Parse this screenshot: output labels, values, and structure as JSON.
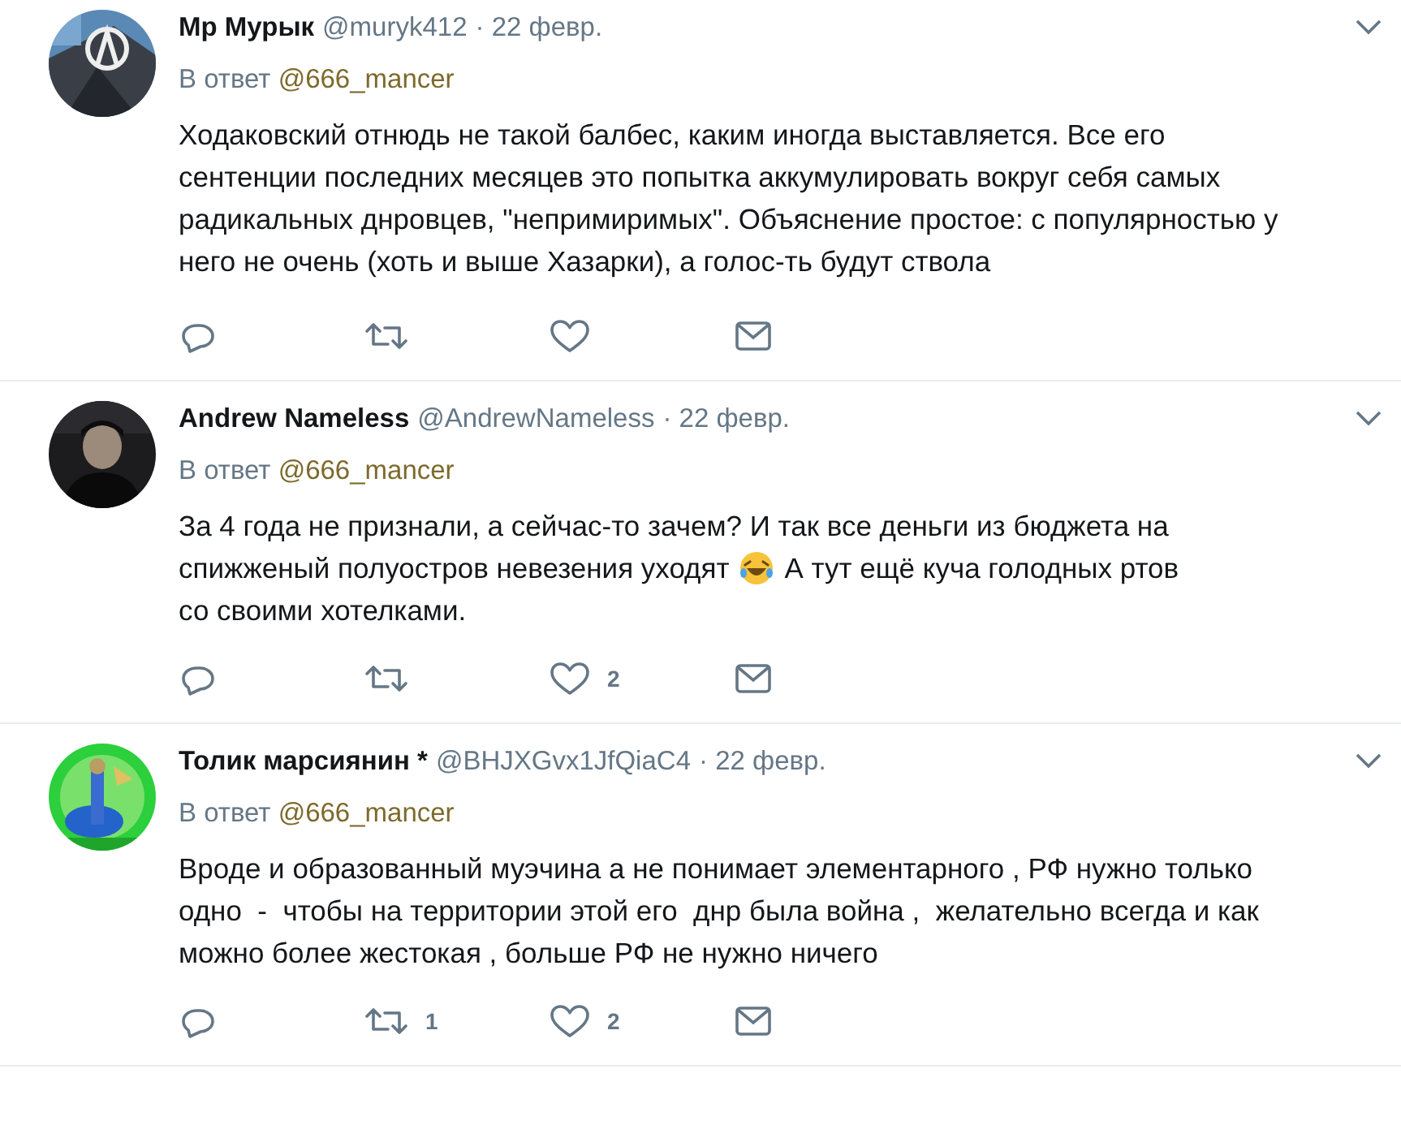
{
  "tweets": [
    {
      "name": "Мр Мурык",
      "handle": "@muryk412",
      "date": "· 22 февр.",
      "reply_prefix": "В ответ",
      "reply_to": "@666_mancer",
      "body": [
        [
          {
            "kind": "text",
            "text": "Ходаковский отнюдь не такой балбес, каким иногда выставляется. Все его сентенции последних месяцев это попытка аккумулировать вокруг себя самых радикальных днровцев, \"непримиримых\". Объяснение простое: с популярностью у него не очень (хоть и выше Хазарки), а голос-ть будут ствола"
          }
        ]
      ]
    },
    {
      "name": "Andrew Nameless",
      "handle": "@AndrewNameless",
      "date": "· 22 февр.",
      "reply_prefix": "В ответ",
      "reply_to": "@666_mancer",
      "body": [
        [
          {
            "kind": "text",
            "text": "За 4 года не признали, а сейчас-то зачем? И так все деньги из бюджета на"
          }
        ],
        [
          {
            "kind": "text",
            "text": "спижженый полуостров невезения уходят"
          },
          {
            "kind": "emoji"
          },
          {
            "kind": "text",
            "text": "А тут ещё куча голодных ртов"
          }
        ],
        [
          {
            "kind": "text",
            "text": "со своими хотелками."
          }
        ]
      ],
      "likes": "2"
    },
    {
      "name": "Толик марсиянин *",
      "handle": "@BHJXGvx1JfQiaC4",
      "date": "· 22 февр.",
      "reply_prefix": "В ответ",
      "reply_to": "@666_mancer",
      "body": [
        [
          {
            "kind": "text",
            "text": "Вроде и образованный муэчина а не понимает элементарного , РФ нужно только одно  -  чтобы на территории этой его  днр была война ,  желательно всегда и как можно более жестокая , больше РФ не нужно ничего"
          }
        ]
      ],
      "retweets": "1",
      "likes": "2"
    }
  ]
}
